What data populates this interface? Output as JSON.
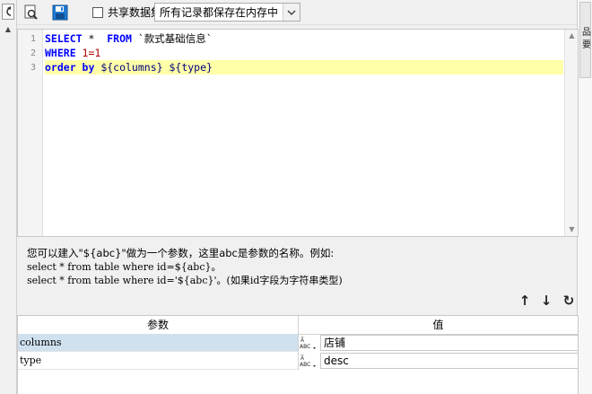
{
  "toolbar": {
    "preview_icon": "magnifier-page-icon",
    "save_icon": "floppy-disk-icon",
    "shared_dataset_checked": false,
    "shared_dataset_label": "共享数据集",
    "save_mode_value": "所有记录都保存在内存中"
  },
  "editor": {
    "line_numbers": [
      "1",
      "2",
      "3"
    ],
    "lines": {
      "l1_kw1": "SELECT",
      "l1_star": " *  ",
      "l1_kw2": "FROM",
      "l1_rest": " `款式基础信息`",
      "l2_kw": "WHERE",
      "l2_rest": " 1=1",
      "l3_kw": "order by",
      "l3_rest": " ${columns} ${type}"
    }
  },
  "help": {
    "line1": "您可以建入\"${abc}\"做为一个参数，这里abc是参数的名称。例如:",
    "line2": "select * from table where id=${abc}。",
    "line3": "select * from table where id='${abc}'。(如果id字段为字符串类型)"
  },
  "param_toolbar": {
    "up_icon": "↑",
    "down_icon": "↓",
    "refresh_icon": "↻"
  },
  "param_table": {
    "headers": {
      "name": "参数",
      "value": "值"
    },
    "rows": [
      {
        "name": "columns",
        "type_label": "ABC",
        "value": "店铺",
        "selected": true
      },
      {
        "name": "type",
        "type_label": "ABC",
        "value": "desc",
        "selected": false
      }
    ]
  },
  "right_panel": {
    "text": "品要"
  },
  "colors": {
    "highlight_line": "#ffffa8",
    "keyword": "#0000ff",
    "selected_row": "#cfe0ee"
  }
}
